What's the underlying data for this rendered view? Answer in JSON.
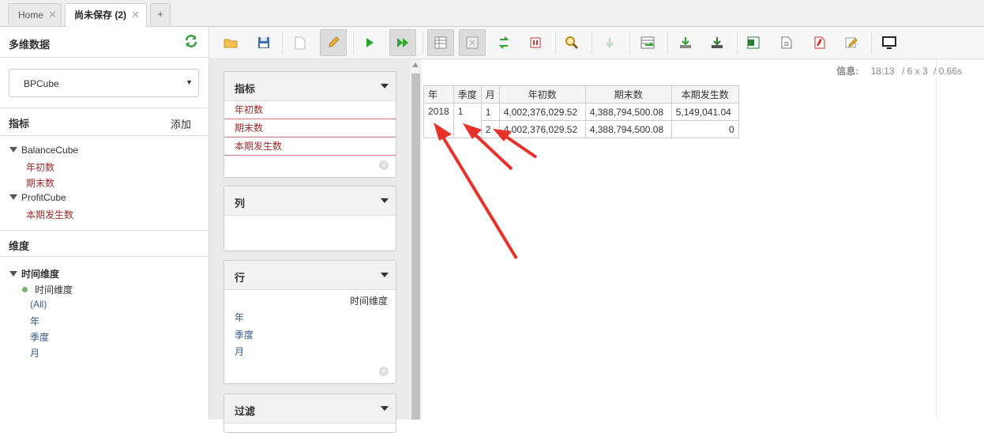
{
  "tabs": [
    {
      "label": "Home",
      "close": "✕",
      "active": false
    },
    {
      "label": "尚未保存 (2)",
      "close": "✕",
      "active": true
    },
    {
      "label": "+",
      "active": false
    }
  ],
  "left": {
    "cube_title": "多维数据",
    "cube_select": "BPCube",
    "measures_title": "指标",
    "measures_add": "添加",
    "measure_tree": [
      {
        "group": "BalanceCube",
        "items": [
          "年初数",
          "期末数"
        ]
      },
      {
        "group": "ProfitCube",
        "items": [
          "本期发生数"
        ]
      }
    ],
    "dimensions_title": "维度",
    "dimension_tree": {
      "root": "时间维度",
      "hierarchy": "时间维度",
      "levels": [
        "(All)",
        "年",
        "季度",
        "月"
      ]
    }
  },
  "toolbar": {
    "icons": [
      "open-folder-icon",
      "save-icon",
      "new-document-icon",
      "edit-pencil-icon",
      "run-icon",
      "auto-run-icon",
      "show-fields-icon",
      "hide-empty-icon",
      "swap-axes-icon",
      "non-empty-icon",
      "zoom-icon",
      "drill-down-icon",
      "drill-through-icon",
      "export-icon",
      "export-all-icon",
      "excel-icon",
      "csv-icon",
      "pdf-icon",
      "chart-edit-icon",
      "fullscreen-icon"
    ]
  },
  "panels": {
    "measures": {
      "title": "指标",
      "fields": [
        "年初数",
        "期末数",
        "本期发生数"
      ]
    },
    "columns": {
      "title": "列"
    },
    "rows": {
      "title": "行",
      "hierarchy": "时间维度",
      "fields": [
        "年",
        "季度",
        "月"
      ]
    },
    "filter": {
      "title": "过滤"
    }
  },
  "info": {
    "label": "信息:",
    "time": "18:13",
    "size": "/ 6 x 3",
    "duration": "/ 0.66s"
  },
  "grid": {
    "headers": [
      "年",
      "季度",
      "月",
      "年初数",
      "期末数",
      "本期发生数"
    ],
    "rows": [
      [
        "2018",
        "1",
        "1",
        "4,002,376,029.52",
        "4,388,794,500.08",
        "5,149,041.04"
      ],
      [
        "",
        "",
        "2",
        "4,002,376,029.52",
        "4,388,794,500.08",
        "0"
      ]
    ]
  },
  "colors": {
    "accent_red": "#9a2b2b",
    "arrow": "#e8312a",
    "link_blue": "#335b8a"
  }
}
